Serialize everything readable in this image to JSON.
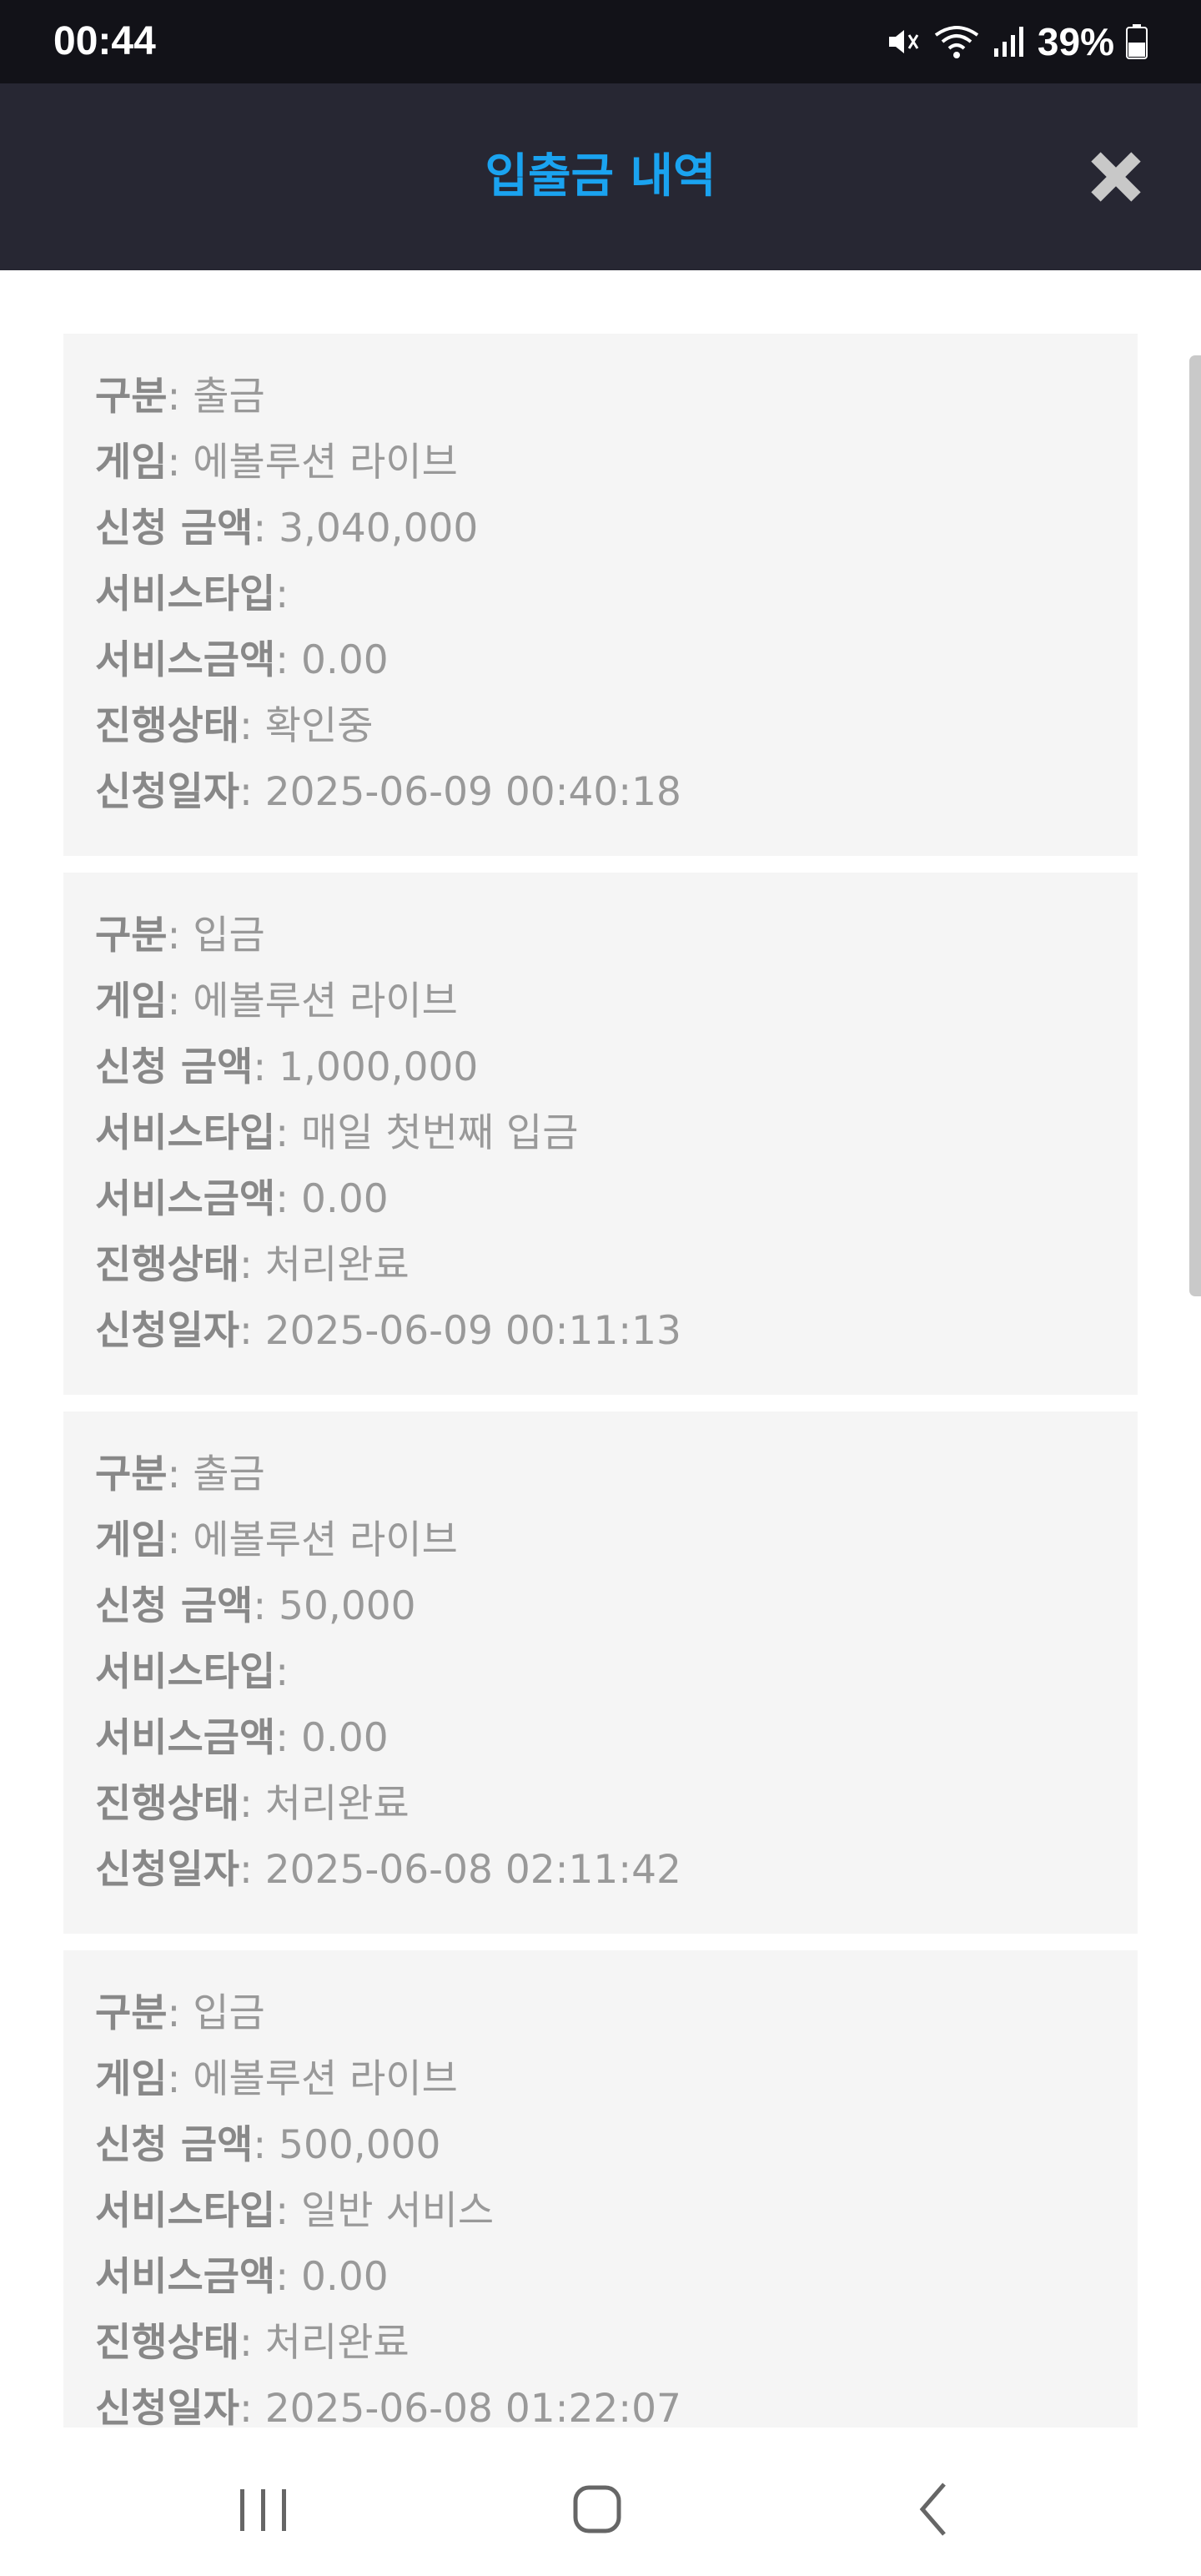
{
  "status_bar": {
    "time": "00:44",
    "battery": "39%",
    "icons": [
      "mute-icon",
      "wifi-icon",
      "signal-icon",
      "battery-icon"
    ]
  },
  "header": {
    "title": "입출금 내역",
    "close_icon": "close-icon"
  },
  "labels": {
    "type": "구분",
    "game": "게임",
    "amount": "신청 금액",
    "service_type": "서비스타입",
    "service_amount": "서비스금액",
    "status": "진행상태",
    "date": "신청일자"
  },
  "records": [
    {
      "type": ": 출금",
      "game": ": 에볼루션 라이브",
      "amount": ": 3,040,000",
      "service_type": ":",
      "service_amount": ": 0.00",
      "status": ": 확인중",
      "date": ": 2025-06-09 00:40:18"
    },
    {
      "type": ": 입금",
      "game": ": 에볼루션 라이브",
      "amount": ": 1,000,000",
      "service_type": ": 매일 첫번째 입금",
      "service_amount": ": 0.00",
      "status": ": 처리완료",
      "date": ": 2025-06-09 00:11:13"
    },
    {
      "type": ": 출금",
      "game": ": 에볼루션 라이브",
      "amount": ": 50,000",
      "service_type": ":",
      "service_amount": ": 0.00",
      "status": ": 처리완료",
      "date": ": 2025-06-08 02:11:42"
    },
    {
      "type": ": 입금",
      "game": ": 에볼루션 라이브",
      "amount": ": 500,000",
      "service_type": ": 일반 서비스",
      "service_amount": ": 0.00",
      "status": ": 처리완료",
      "date": ": 2025-06-08 01:22:07"
    }
  ],
  "colors": {
    "header_bg": "#272733",
    "title": "#1aa3f0",
    "card_bg": "#f5f5f5",
    "text": "#999999"
  },
  "nav": {
    "recents_icon": "recents-icon",
    "home_icon": "home-icon",
    "back_icon": "back-icon"
  }
}
